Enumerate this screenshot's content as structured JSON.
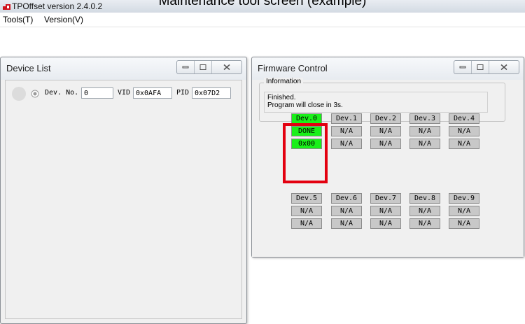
{
  "app": {
    "title": "TPOffset version 2.4.0.2",
    "caption": "Maintenance tool screen (example)"
  },
  "menu": [
    {
      "label": "Tools(T)"
    },
    {
      "label": "Version(V)"
    }
  ],
  "device_list": {
    "title": "Device List",
    "row": {
      "dev_no_label": "Dev. No.",
      "dev_no_value": "0",
      "vid_label": "VID",
      "vid_value": "0x0AFA",
      "pid_label": "PID",
      "pid_value": "0x07D2"
    }
  },
  "firmware_control": {
    "title": "Firmware Control",
    "info_group_label": "Information",
    "info_lines": [
      "Finished.",
      "Program will close in 3s."
    ],
    "devices": [
      {
        "name": "Dev.0",
        "status": "DONE",
        "value": "0x00",
        "active": true
      },
      {
        "name": "Dev.1",
        "status": "N/A",
        "value": "N/A",
        "active": false
      },
      {
        "name": "Dev.2",
        "status": "N/A",
        "value": "N/A",
        "active": false
      },
      {
        "name": "Dev.3",
        "status": "N/A",
        "value": "N/A",
        "active": false
      },
      {
        "name": "Dev.4",
        "status": "N/A",
        "value": "N/A",
        "active": false
      },
      {
        "name": "Dev.5",
        "status": "N/A",
        "value": "N/A",
        "active": false
      },
      {
        "name": "Dev.6",
        "status": "N/A",
        "value": "N/A",
        "active": false
      },
      {
        "name": "Dev.7",
        "status": "N/A",
        "value": "N/A",
        "active": false
      },
      {
        "name": "Dev.8",
        "status": "N/A",
        "value": "N/A",
        "active": false
      },
      {
        "name": "Dev.9",
        "status": "N/A",
        "value": "N/A",
        "active": false
      }
    ]
  },
  "colors": {
    "active_cell": "#19f019",
    "inactive_cell": "#c8c8c8",
    "highlight": "#e3000f"
  },
  "icons": {
    "app": "app-logo-icon",
    "minimize": "minimize-icon",
    "maximize": "maximize-icon",
    "close": "close-icon",
    "status_led": "status-led-icon",
    "radio": "radio-button-icon"
  }
}
